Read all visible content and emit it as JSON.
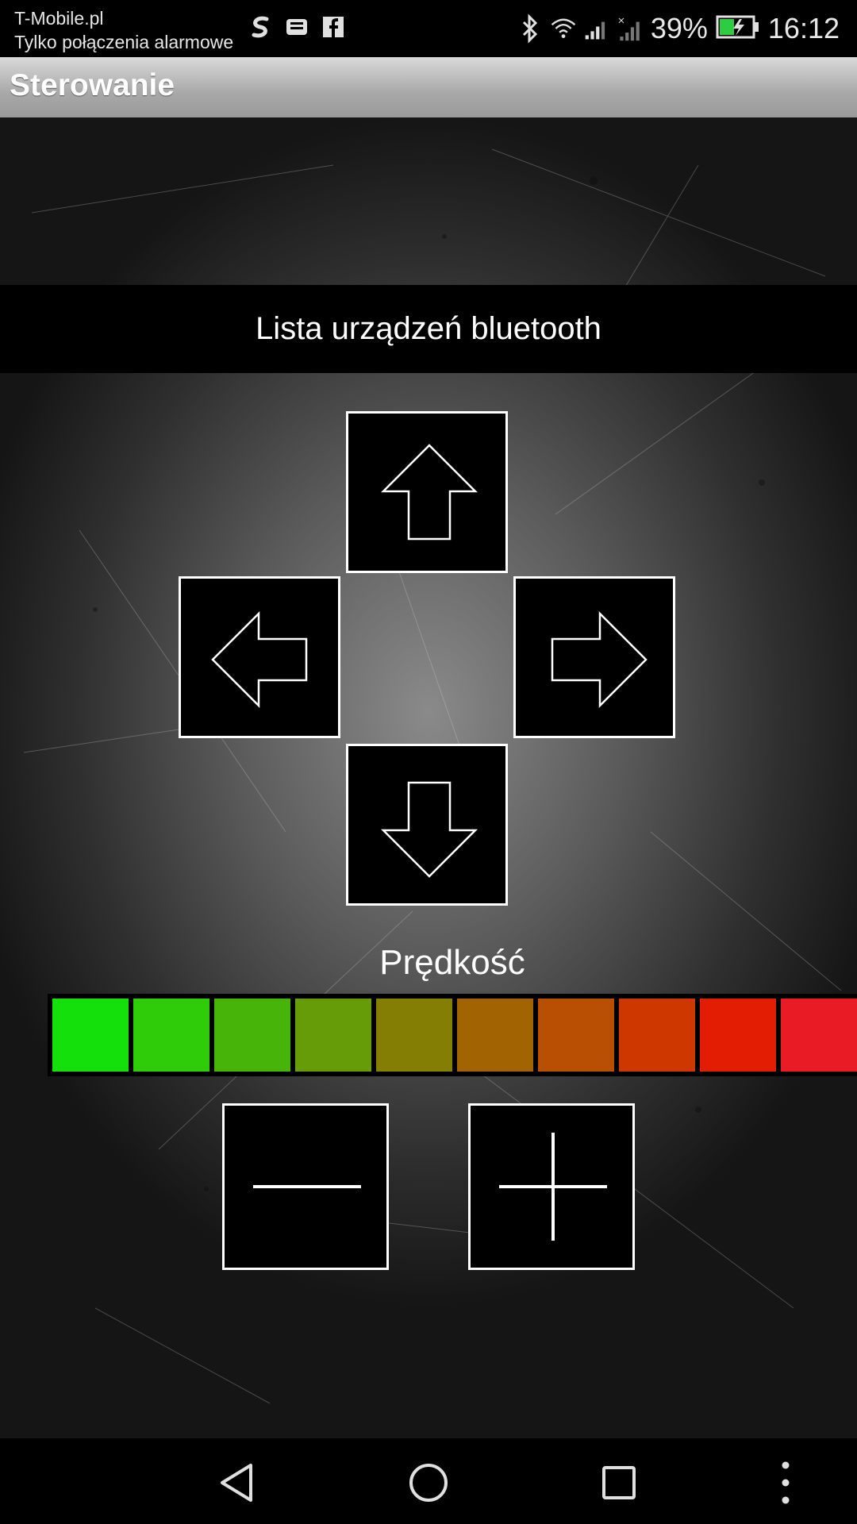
{
  "status_bar": {
    "carrier": "T-Mobile.pl",
    "emergency_text": "Tylko połączenia alarmowe",
    "battery": "39%",
    "time": "16:12",
    "icons": [
      "swype-icon",
      "printer-icon",
      "facebook-icon",
      "bluetooth-icon",
      "wifi-icon",
      "signal-icon",
      "no-signal-icon",
      "battery-charging-icon"
    ],
    "battery_color": "#2ecc40"
  },
  "action_bar": {
    "title": "Sterowanie"
  },
  "bluetooth_button": {
    "label": "Lista urządzeń bluetooth"
  },
  "dpad": {
    "icons": [
      "arrow-up-icon",
      "arrow-left-icon",
      "arrow-right-icon",
      "arrow-down-icon"
    ]
  },
  "speed": {
    "label": "Prędkość",
    "segments": 10,
    "segment_colors": [
      "#14e10b",
      "#2fcc0a",
      "#47b40a",
      "#659c07",
      "#847f04",
      "#a26402",
      "#b94f02",
      "#cf3701",
      "#e31d03",
      "#e91c26"
    ]
  },
  "speed_controls": {
    "icons": [
      "minus-icon",
      "plus-icon"
    ]
  },
  "nav_bar": {
    "icons": [
      "back-icon",
      "home-icon",
      "recents-icon",
      "menu-icon"
    ]
  }
}
